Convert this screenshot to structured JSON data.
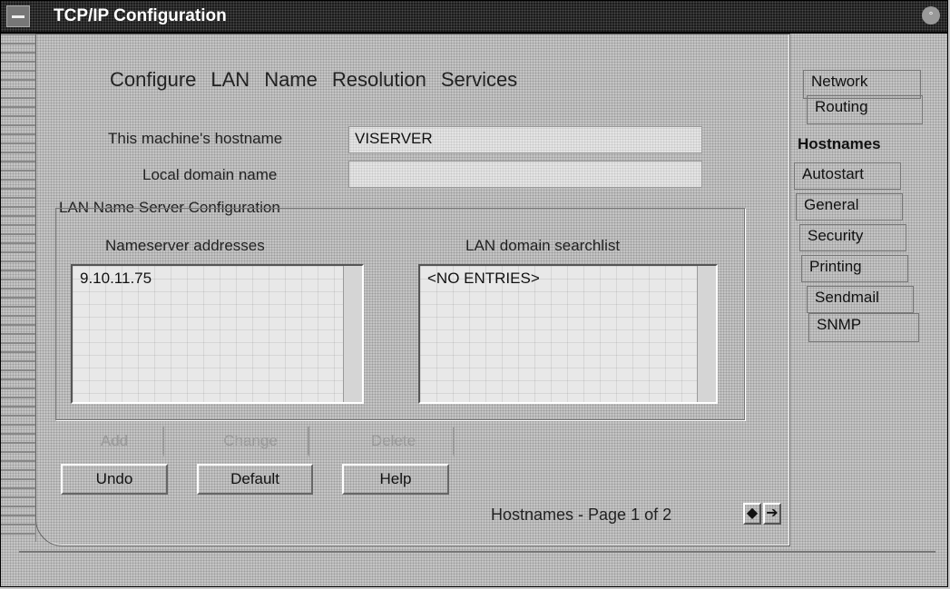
{
  "window": {
    "title": "TCP/IP Configuration"
  },
  "heading": [
    "Configure",
    "LAN",
    "Name",
    "Resolution",
    "Services"
  ],
  "form": {
    "hostname_label": "This machine's hostname",
    "hostname_value": "VISERVER",
    "domain_label": "Local domain name",
    "domain_value": ""
  },
  "group": {
    "title": "LAN Name Server Configuration",
    "nameserver_header": "Nameserver addresses",
    "searchlist_header": "LAN domain searchlist",
    "nameservers": [
      "9.10.11.75"
    ],
    "searchlist": [
      "<NO ENTRIES>"
    ]
  },
  "buttons": {
    "add": "Add",
    "change": "Change",
    "delete": "Delete",
    "undo": "Undo",
    "default": "Default",
    "help": "Help"
  },
  "tabs": [
    "Network",
    "Routing",
    "Hostnames",
    "Autostart",
    "General",
    "Security",
    "Printing",
    "Sendmail",
    "SNMP"
  ],
  "active_tab": "Hostnames",
  "page_indicator": "Hostnames - Page 1 of 2",
  "icons": {
    "prev": "left-arrow-icon",
    "next": "right-arrow-icon",
    "system": "system-menu-icon",
    "close": "close-icon"
  }
}
